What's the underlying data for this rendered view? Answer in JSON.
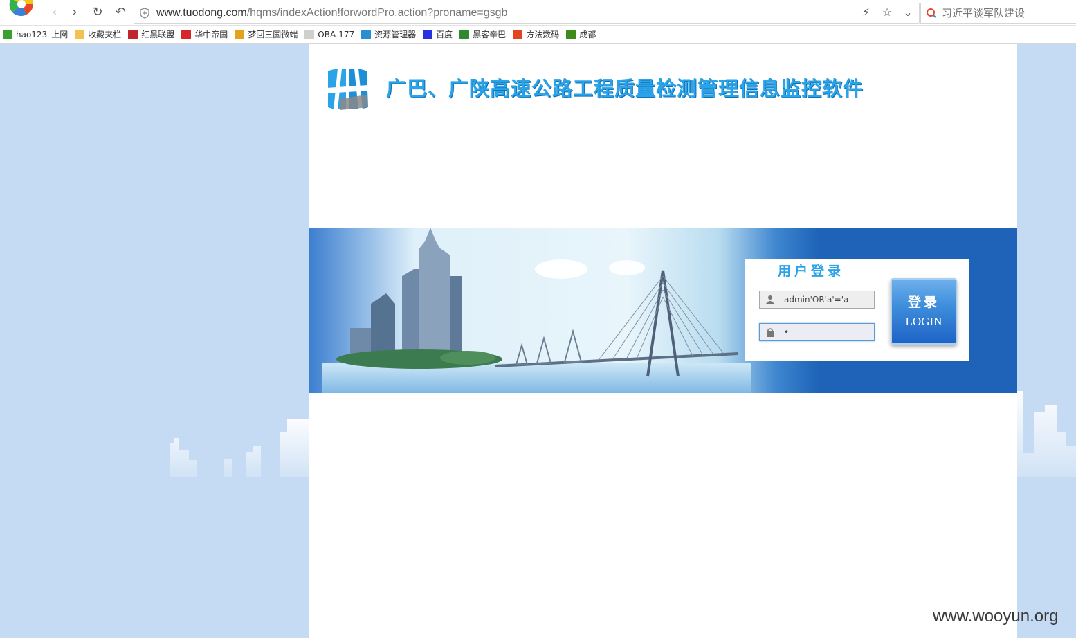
{
  "browser": {
    "url_main": "www.tuodong.com",
    "url_rest": "/hqms/indexAction!forwordPro.action?proname=gsgb",
    "search_placeholder": "习近平谈军队建设",
    "bookmarks": [
      {
        "label": "hao123_上网",
        "icon": "hao123-icon",
        "color": "#3aa02e"
      },
      {
        "label": "收藏夹栏",
        "icon": "folder-icon",
        "color": "#f2c14e"
      },
      {
        "label": "红黑联盟",
        "icon": "shield-icon",
        "color": "#c0262b"
      },
      {
        "label": "华中帝国",
        "icon": "bird-icon",
        "color": "#d6262a"
      },
      {
        "label": "梦回三国微端",
        "icon": "game-icon",
        "color": "#e3a21a"
      },
      {
        "label": "OBA-177",
        "icon": "page-icon",
        "color": "#cfcfcf"
      },
      {
        "label": "资源管理器",
        "icon": "globe-icon",
        "color": "#2a8fd0"
      },
      {
        "label": "百度",
        "icon": "paw-icon",
        "color": "#2932e1"
      },
      {
        "label": "黑客辛巴",
        "icon": "tree-icon",
        "color": "#2f8a2f"
      },
      {
        "label": "方法数码",
        "icon": "diamond-icon",
        "color": "#e0461f"
      },
      {
        "label": "成都",
        "icon": "chart-icon",
        "color": "#3e8b1b"
      }
    ]
  },
  "site": {
    "title": "广巴、广陕高速公路工程质量检测管理信息监控软件"
  },
  "login": {
    "title": "用户登录",
    "username_value": "admin'OR'a'='a",
    "password_value": "•",
    "button_cn": "登录",
    "button_en": "LOGIN"
  },
  "watermark": "www.wooyun.org"
}
